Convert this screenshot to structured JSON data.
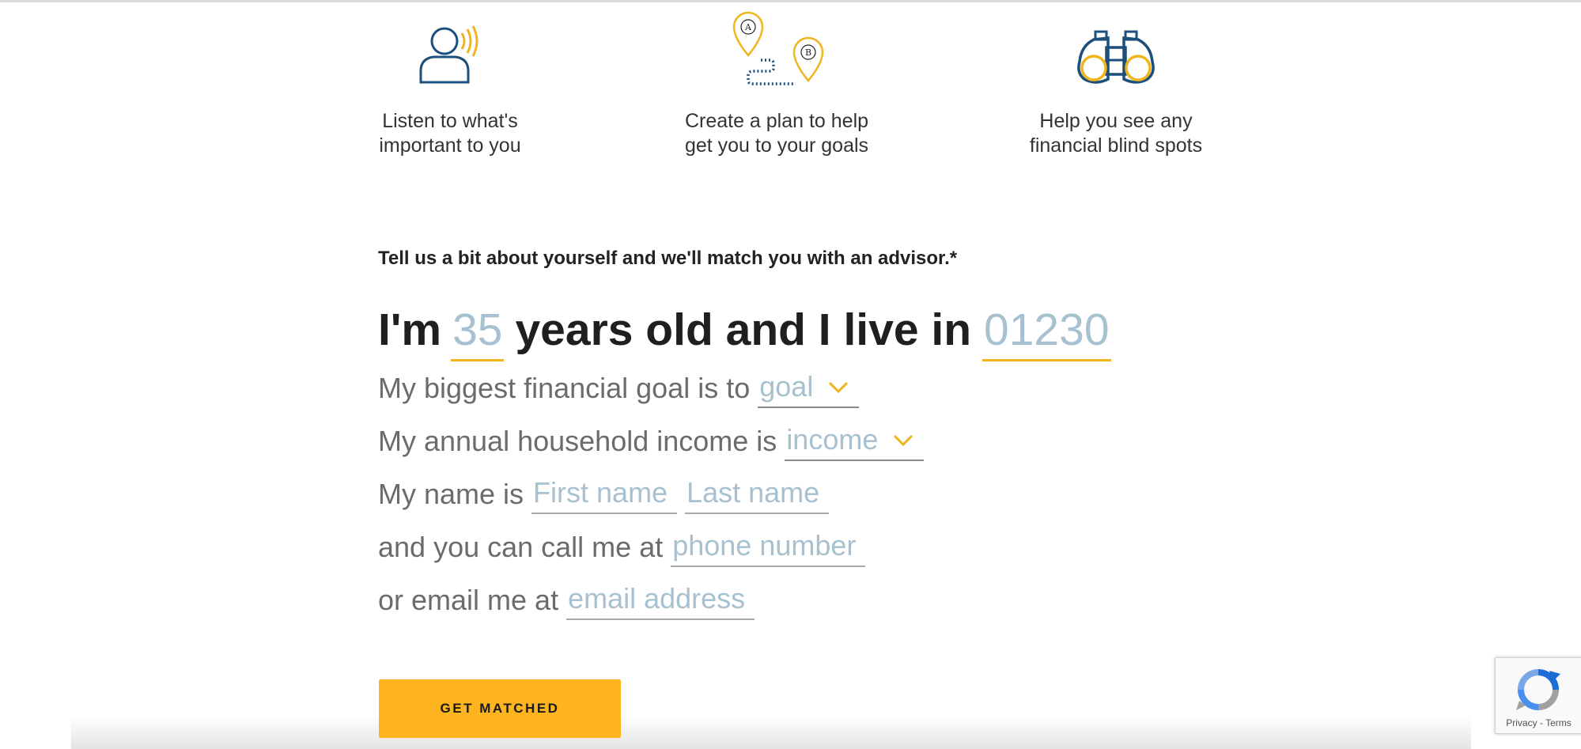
{
  "benefits": [
    {
      "label_line1": "Listen to what's",
      "label_line2": "important to you",
      "icon": "listening-person-icon"
    },
    {
      "label_line1": "Create a plan to help",
      "label_line2": "get you to your goals",
      "icon": "route-map-pins-icon",
      "pin_a": "A",
      "pin_b": "B"
    },
    {
      "label_line1": "Help you see any",
      "label_line2": "financial blind spots",
      "icon": "binoculars-icon"
    }
  ],
  "form": {
    "intro": "Tell us a bit about yourself and we'll match you with an advisor.*",
    "headline": {
      "part1": "I'm",
      "age_value": "35",
      "part2": "years old and I live in",
      "zip_value": "01230"
    },
    "goal": {
      "text": "My biggest financial goal is to",
      "placeholder": "goal"
    },
    "income": {
      "text": "My annual household income is",
      "placeholder": "income"
    },
    "name": {
      "text": "My name is",
      "first_placeholder": "First name",
      "last_placeholder": "Last name"
    },
    "phone": {
      "text": "and you can call me at",
      "placeholder": "phone number"
    },
    "email": {
      "text": "or email me at",
      "placeholder": "email address"
    },
    "submit_label": "GET MATCHED"
  },
  "recaptcha": {
    "privacy": "Privacy",
    "separator": " - ",
    "terms": "Terms"
  },
  "colors": {
    "accent": "#fdb41f",
    "icon_blue": "#1c4f7c",
    "icon_gold": "#f0b51d",
    "field_text": "#a7c1d0",
    "headline": "#1f1f1f"
  }
}
